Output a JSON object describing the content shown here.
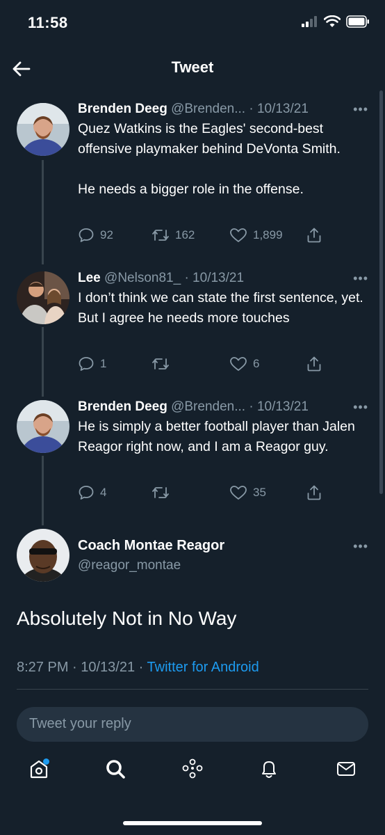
{
  "status_bar": {
    "time": "11:58"
  },
  "header": {
    "title": "Tweet"
  },
  "thread": [
    {
      "name": "Brenden Deeg",
      "handle": "@Brenden...",
      "date": "· 10/13/21",
      "text": "Quez Watkins is the Eagles' second-best offensive playmaker behind DeVonta Smith.\n\nHe needs a bigger role in the offense.",
      "replies": "92",
      "retweets": "162",
      "likes": "1,899"
    },
    {
      "name": "Lee",
      "handle": "@Nelson81_",
      "date": "· 10/13/21",
      "text": "I don’t think we can state the first sentence, yet. But I agree he needs more touches",
      "replies": "1",
      "retweets": "",
      "likes": "6"
    },
    {
      "name": "Brenden Deeg",
      "handle": "@Brenden...",
      "date": "· 10/13/21",
      "text": "He is simply a better football player than Jalen Reagor right now, and I am a Reagor guy.",
      "replies": "4",
      "retweets": "",
      "likes": "35"
    }
  ],
  "main_tweet": {
    "name": "Coach Montae Reagor",
    "handle": "@reagor_montae",
    "text": "Absolutely Not in No Way",
    "time": "8:27 PM · 10/13/21 ·",
    "source": "Twitter for Android"
  },
  "reply": {
    "placeholder": "Tweet your reply"
  },
  "tab_bar": {
    "items": [
      "home-icon",
      "search-icon",
      "spaces-icon",
      "notifications-icon",
      "messages-icon"
    ]
  },
  "colors": {
    "background": "#15202b",
    "secondary_text": "#8899a6",
    "accent": "#1d9bf0",
    "divider": "#38444d"
  }
}
